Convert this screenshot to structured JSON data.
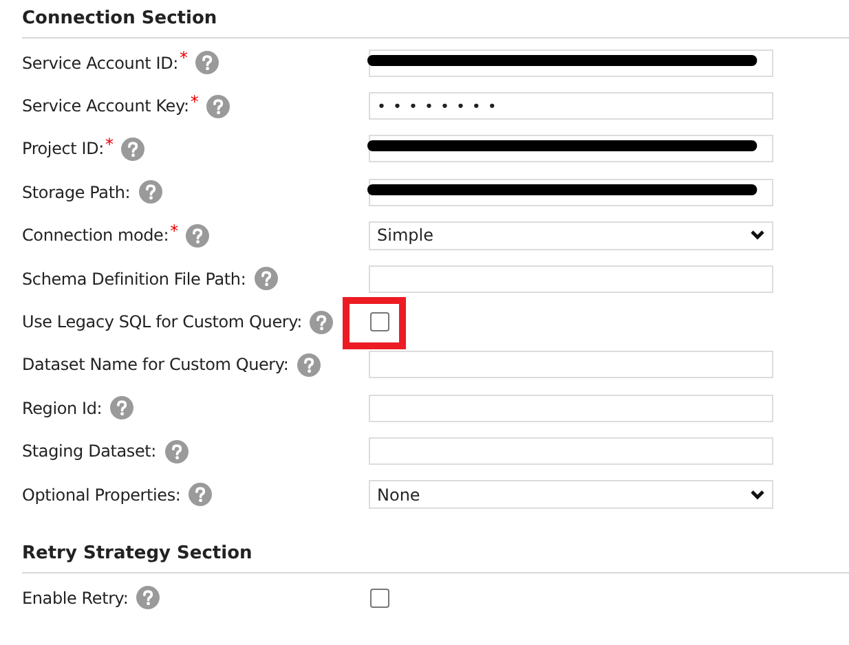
{
  "sections": [
    {
      "title": "Connection Section",
      "fields": [
        {
          "label": "Service Account ID:",
          "required_mark": "*",
          "kind": "text",
          "redacted": true
        },
        {
          "label": "Service Account Key:",
          "required_mark": "*",
          "kind": "password",
          "value": "••••••••"
        },
        {
          "label": "Project ID:",
          "required_mark": "*",
          "kind": "text",
          "redacted": true
        },
        {
          "label": "Storage Path:",
          "kind": "text",
          "redacted": true
        },
        {
          "label": "Connection mode:",
          "required_mark": "*",
          "kind": "select",
          "value": "Simple"
        },
        {
          "label": "Schema Definition File Path:",
          "kind": "text"
        },
        {
          "label": "Use Legacy SQL for Custom Query:",
          "kind": "checkbox",
          "checked": false,
          "highlighted": true
        },
        {
          "label": "Dataset Name for Custom Query:",
          "kind": "text"
        },
        {
          "label": "Region Id:",
          "kind": "text"
        },
        {
          "label": "Staging Dataset:",
          "kind": "text"
        },
        {
          "label": "Optional Properties:",
          "kind": "select",
          "value": "None"
        }
      ]
    },
    {
      "title": "Retry Strategy Section",
      "fields": [
        {
          "label": "Enable Retry:",
          "kind": "checkbox",
          "checked": false
        }
      ]
    }
  ]
}
